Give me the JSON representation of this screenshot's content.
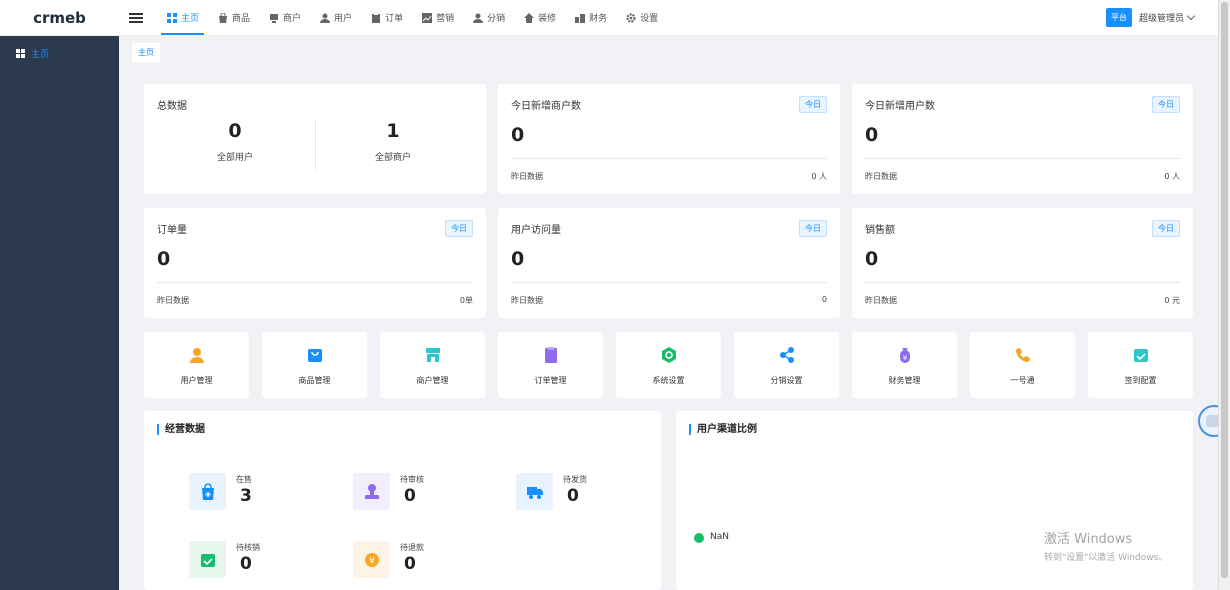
{
  "app": {
    "logo_text": "crmeb"
  },
  "topnav": {
    "items": [
      {
        "label": "主页",
        "icon": "dashboard-icon",
        "active": true
      },
      {
        "label": "商品",
        "icon": "bag-icon"
      },
      {
        "label": "商户",
        "icon": "store-icon"
      },
      {
        "label": "用户",
        "icon": "user-icon"
      },
      {
        "label": "订单",
        "icon": "clipboard-icon"
      },
      {
        "label": "营销",
        "icon": "chart-icon"
      },
      {
        "label": "分销",
        "icon": "user-share-icon"
      },
      {
        "label": "装修",
        "icon": "home-icon"
      },
      {
        "label": "财务",
        "icon": "building-icon"
      },
      {
        "label": "设置",
        "icon": "gear-icon"
      }
    ],
    "platform_badge": "平台",
    "admin_name": "超级管理员"
  },
  "sidebar": {
    "items": [
      {
        "label": "主页"
      }
    ]
  },
  "tagbar": {
    "active_tag": "主页"
  },
  "totals": {
    "title": "总数据",
    "users": {
      "value": "0",
      "label": "全部用户"
    },
    "merchants": {
      "value": "1",
      "label": "全部商户"
    }
  },
  "stats": [
    {
      "title": "今日新增商户数",
      "badge": "今日",
      "value": "0",
      "foot_label": "昨日数据",
      "foot_value": "0 人"
    },
    {
      "title": "今日新增用户数",
      "badge": "今日",
      "value": "0",
      "foot_label": "昨日数据",
      "foot_value": "0 人"
    },
    {
      "title": "订单量",
      "badge": "今日",
      "value": "0",
      "foot_label": "昨日数据",
      "foot_value": "0单"
    },
    {
      "title": "用户访问量",
      "badge": "今日",
      "value": "0",
      "foot_label": "昨日数据",
      "foot_value": "0"
    },
    {
      "title": "销售额",
      "badge": "今日",
      "value": "0",
      "foot_label": "昨日数据",
      "foot_value": "0 元"
    }
  ],
  "quick_entries": [
    {
      "label": "用户管理",
      "icon": "user-icon",
      "color": "#f5a623"
    },
    {
      "label": "商品管理",
      "icon": "bag-icon",
      "color": "#1890ff"
    },
    {
      "label": "商户管理",
      "icon": "store-icon",
      "color": "#2ec7c9"
    },
    {
      "label": "订单管理",
      "icon": "clipboard-icon",
      "color": "#8e6cf0"
    },
    {
      "label": "系统设置",
      "icon": "hexagon-gear-icon",
      "color": "#19be6b"
    },
    {
      "label": "分销设置",
      "icon": "share-icon",
      "color": "#1890ff"
    },
    {
      "label": "财务管理",
      "icon": "money-bag-icon",
      "color": "#8e6cf0"
    },
    {
      "label": "一号通",
      "icon": "phone-icon",
      "color": "#f5a623"
    },
    {
      "label": "签到配置",
      "icon": "calendar-check-icon",
      "color": "#2ec7c9"
    }
  ],
  "operations": {
    "title": "经营数据",
    "items": [
      {
        "label": "在售",
        "value": "3",
        "icon": "bag-plus-icon",
        "bg": "#e8f3ff",
        "color": "#1890ff"
      },
      {
        "label": "待审核",
        "value": "0",
        "icon": "stamp-icon",
        "bg": "#f3eefe",
        "color": "#8e6cf0"
      },
      {
        "label": "待发货",
        "value": "0",
        "icon": "truck-icon",
        "bg": "#e8f3ff",
        "color": "#1890ff"
      },
      {
        "label": "待核销",
        "value": "0",
        "icon": "calendar-check-icon",
        "bg": "#e6f7ee",
        "color": "#19be6b"
      },
      {
        "label": "待退款",
        "value": "0",
        "icon": "yen-coin-icon",
        "bg": "#fff3e6",
        "color": "#f5a623"
      }
    ]
  },
  "channel": {
    "title": "用户渠道比例",
    "legend": [
      {
        "label": "NaN",
        "color": "#19be6b"
      }
    ]
  },
  "windows_watermark": {
    "title": "激活 Windows",
    "subtitle": "转到\"设置\"以激活 Windows。"
  }
}
